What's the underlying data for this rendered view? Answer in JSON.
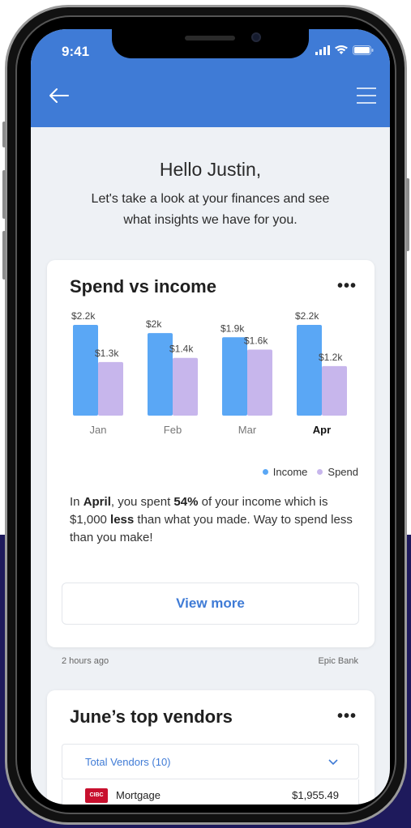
{
  "status_bar": {
    "time": "9:41"
  },
  "greeting": {
    "title": "Hello Justin,",
    "subtitle": "Let's take a look at your finances and see what insights we have for you."
  },
  "spend_card": {
    "title": "Spend vs income",
    "more": "•••",
    "insight": {
      "part1": "In ",
      "month": "April",
      "part2": ", you spent ",
      "percent": "54%",
      "part3": " of your income which is $1,000 ",
      "less": "less",
      "part4": " than what you made. Way to spend less than you make!"
    },
    "view_more": "View more",
    "timestamp": "2 hours ago",
    "source": "Epic Bank"
  },
  "chart_data": {
    "type": "bar",
    "categories": [
      "Jan",
      "Feb",
      "Mar",
      "Apr"
    ],
    "series": [
      {
        "name": "Income",
        "values": [
          2.2,
          2.0,
          1.9,
          2.2
        ],
        "labels": [
          "$2.2k",
          "$2k",
          "$1.9k",
          "$2.2k"
        ],
        "color": "#5aa7f5"
      },
      {
        "name": "Spend",
        "values": [
          1.3,
          1.4,
          1.6,
          1.2
        ],
        "labels": [
          "$1.3k",
          "$1.4k",
          "$1.6k",
          "$1.2k"
        ],
        "color": "#c7b6ec"
      }
    ],
    "highlight_category": "Apr",
    "ylim": [
      0,
      2.2
    ],
    "legend_position": "bottom-right",
    "grid": false
  },
  "vendors_card": {
    "title": "June’s top vendors",
    "more": "•••",
    "filter_label": "Total Vendors (10)",
    "rows": [
      {
        "logo_text": "CIBC",
        "name": "Mortgage",
        "amount": "$1,955.49"
      }
    ]
  },
  "colors": {
    "primary": "#3f7bd6",
    "income": "#5aa7f5",
    "spend": "#c7b6ec",
    "background": "#eef1f5",
    "backdrop": "#1e1a5c"
  },
  "icons": {
    "back": "arrow-left-icon",
    "menu": "hamburger-menu-icon",
    "signal": "signal-icon",
    "wifi": "wifi-icon",
    "battery": "battery-icon",
    "chevron": "chevron-down-icon"
  }
}
